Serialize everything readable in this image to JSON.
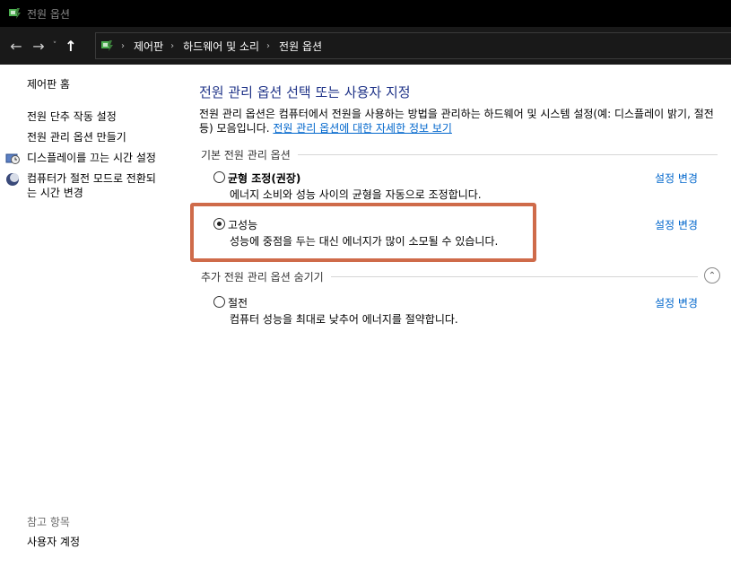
{
  "window": {
    "title": "전원 옵션"
  },
  "nav": {
    "back_glyph": "←",
    "forward_glyph": "→",
    "recent_glyph": "˅",
    "up_glyph": "↑",
    "breadcrumb": [
      "제어판",
      "하드웨어 및 소리",
      "전원 옵션"
    ],
    "separator": "›"
  },
  "sidebar": {
    "home": "제어판 홈",
    "links": [
      "전원 단추 작동 설정",
      "전원 관리 옵션 만들기",
      "디스플레이를 끄는 시간 설정",
      "컴퓨터가 절전 모드로 전환되",
      "는 시간 변경"
    ],
    "see_also_title": "참고 항목",
    "see_also_links": [
      "사용자 계정"
    ]
  },
  "main": {
    "heading": "전원 관리 옵션 선택 또는 사용자 지정",
    "description": "전원 관리 옵션은 컴퓨터에서 전원을 사용하는 방법을 관리하는 하드웨어 및 시스템 설정(예: 디스플레이 밝기, 절전 등) 모음입니다.",
    "description_link": "전원 관리 옵션에 대한 자세한 정보 보기",
    "basic_group": "기본 전원 관리 옵션",
    "more_group": "추가 전원 관리 옵션 숨기기",
    "collapse_glyph": "⌃",
    "change_label": "설정 변경",
    "plans": [
      {
        "name": "균형 조정(권장)",
        "desc": "에너지 소비와 성능 사이의 균형을 자동으로 조정합니다.",
        "selected": false
      },
      {
        "name": "고성능",
        "desc": "성능에 중점을 두는 대신 에너지가 많이 소모될 수 있습니다.",
        "selected": true
      },
      {
        "name": "절전",
        "desc": "컴퓨터 성능을 최대로 낮추어 에너지를 절약합니다.",
        "selected": false
      }
    ]
  },
  "colors": {
    "heading": "#1e3287",
    "link": "#0066cc",
    "highlight_border": "#cf6b4a",
    "titlebar": "#000000",
    "navbar": "#191919"
  },
  "icons": {
    "title": "power-options-icon",
    "address": "control-panel-icon",
    "display": "display-clock-icon",
    "sleep": "moon-icon"
  }
}
